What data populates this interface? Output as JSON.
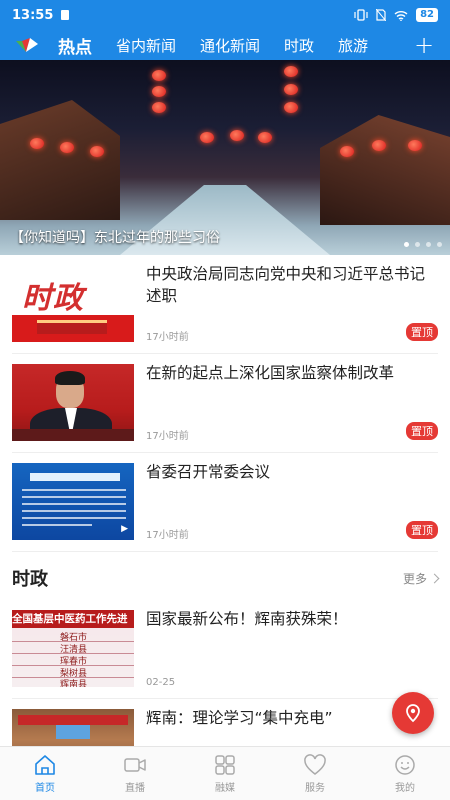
{
  "status_bar": {
    "time": "13:55",
    "battery": "82"
  },
  "colors": {
    "brand": "#1e88e5",
    "pin_badge": "#e53935",
    "fab": "#e53935"
  },
  "tabs": [
    {
      "label": "热点",
      "active": true
    },
    {
      "label": "省内新闻",
      "active": false
    },
    {
      "label": "通化新闻",
      "active": false
    },
    {
      "label": "时政",
      "active": false
    },
    {
      "label": "旅游",
      "active": false
    }
  ],
  "tab_add_label": "+",
  "banner": {
    "caption": "【你知道吗】东北过年的那些习俗",
    "dot_count": 4,
    "active_dot": 0
  },
  "hot_news": [
    {
      "title": "中央政治局同志向党中央和习近平总书记述职",
      "time": "17小时前",
      "badge": "置顶",
      "thumb_text": "时政",
      "thumb_icon": "shizheng-thumbnail"
    },
    {
      "title": "在新的起点上深化国家监察体制改革",
      "time": "17小时前",
      "badge": "置顶",
      "thumb_icon": "portrait-thumbnail"
    },
    {
      "title": "省委召开常委会议",
      "time": "17小时前",
      "badge": "置顶",
      "thumb_text": "省委召开常委会议",
      "thumb_icon": "document-thumbnail"
    }
  ],
  "section": {
    "title": "时政",
    "more_label": "更多"
  },
  "politics_news": [
    {
      "title": "国家最新公布！辉南获殊荣！",
      "time": "02-25",
      "thumb_header": "全国基层中医药工作先进",
      "thumb_rows": [
        "磐石市",
        "汪清县",
        "珲春市",
        "梨树县",
        "辉南县"
      ]
    },
    {
      "title": "辉南：理论学习“集中充电”",
      "time": ""
    }
  ],
  "fab_icon": "location-pin-icon",
  "bottom_nav": [
    {
      "label": "首页",
      "icon": "home-icon",
      "active": true
    },
    {
      "label": "直播",
      "icon": "video-camera-icon",
      "active": false
    },
    {
      "label": "融媒",
      "icon": "grid-icon",
      "active": false
    },
    {
      "label": "服务",
      "icon": "heart-icon",
      "active": false
    },
    {
      "label": "我的",
      "icon": "smile-icon",
      "active": false
    }
  ]
}
